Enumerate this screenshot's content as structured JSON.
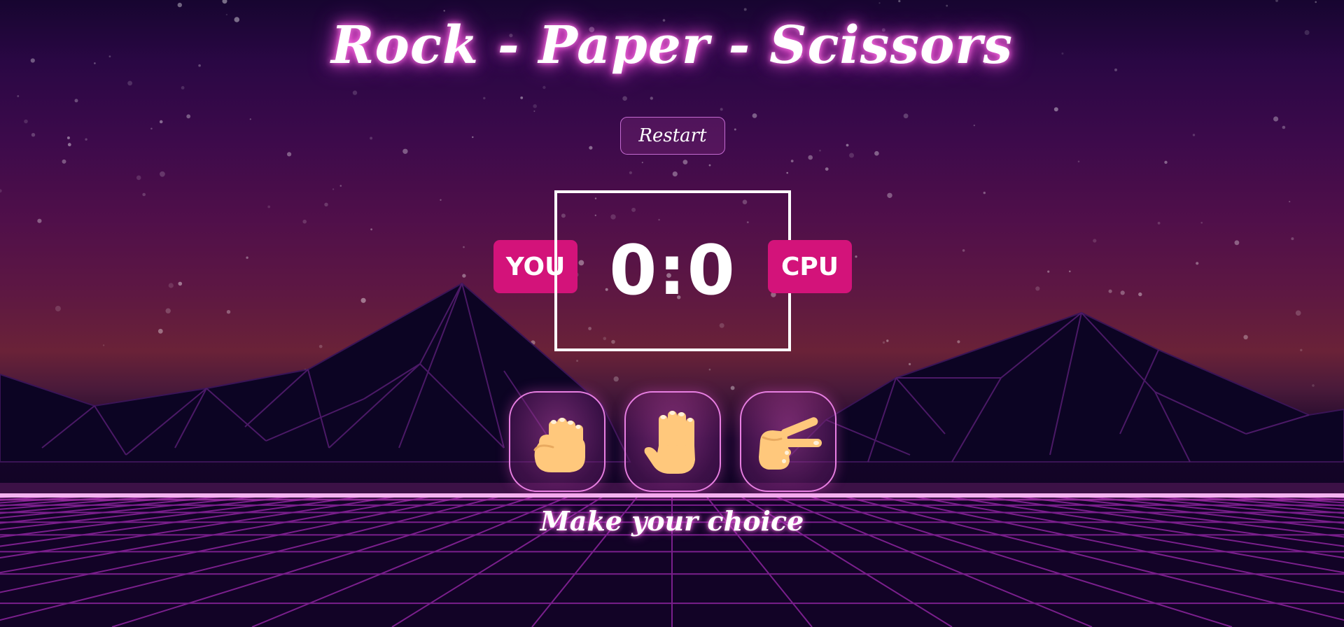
{
  "header": {
    "title": "Rock - Paper - Scissors"
  },
  "controls": {
    "restart_label": "Restart"
  },
  "scoreboard": {
    "player_label": "YOU",
    "cpu_label": "CPU",
    "score": "0:0"
  },
  "choices": [
    {
      "name": "rock",
      "icon": "rock-hand-icon"
    },
    {
      "name": "paper",
      "icon": "paper-hand-icon"
    },
    {
      "name": "scissors",
      "icon": "scissors-hand-icon"
    }
  ],
  "status": {
    "message": "Make your choice"
  },
  "theme": {
    "accent_pink": "#d3137a",
    "glow_pink": "#ff4fd8",
    "grid_color": "#7a1f8c",
    "skin_color": "#ffc87c"
  }
}
